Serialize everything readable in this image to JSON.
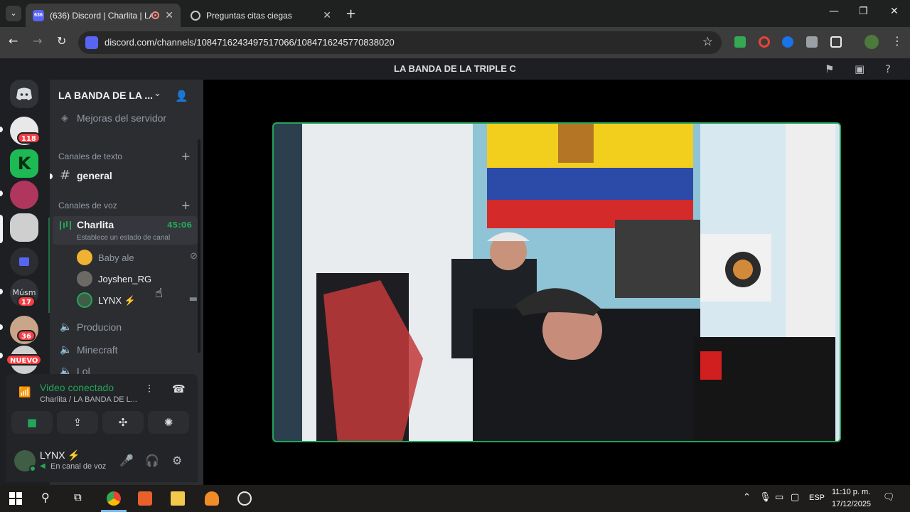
{
  "browser": {
    "tabs": [
      {
        "title": "(636) Discord | Charlita | LA",
        "favicon_badge": "636",
        "active": true,
        "recording": true
      },
      {
        "title": "Preguntas citas ciegas",
        "active": false
      }
    ],
    "url": "discord.com/channels/1084716243497517066/1084716245770838020",
    "icons": [
      "tab-search-icon",
      "close-icon",
      "new-tab-icon",
      "minimize-icon",
      "restore-icon",
      "back-icon",
      "forward-icon",
      "reload-icon",
      "star-icon",
      "extensions-icon",
      "more-icon"
    ]
  },
  "discord": {
    "title": "LA BANDA DE LA TRIPLE C",
    "guild_name": "LA BANDA DE LA ...",
    "boosts": "Mejoras del servidor",
    "text_category": "Canales de texto",
    "text_channels": [
      "general"
    ],
    "voice_category": "Canales de voz",
    "active_voice": {
      "name": "Charlita",
      "time": "45:06",
      "status_hint": "Establece un estado de canal",
      "members": [
        {
          "name": "Baby ale",
          "color": "#949ba4",
          "avatar_color": "#f0b232"
        },
        {
          "name": "Joyshen_RG",
          "color": "#f2f3f5",
          "avatar_color": "#6d6a66"
        },
        {
          "name": "LYNX ⚡",
          "color": "#f2f3f5",
          "avatar_color": "#3f5e45"
        }
      ]
    },
    "other_voice": [
      "Producion",
      "Minecraft",
      "Lol"
    ],
    "servers": [
      {
        "badge": "118",
        "color": "#e8e8e8"
      },
      {
        "badge": "",
        "color": "#1db954"
      },
      {
        "badge": "",
        "color": "#b0365e"
      },
      {
        "badge": "",
        "color": "#cfcfcf"
      },
      {
        "badge": "",
        "color": "#5865f2"
      },
      {
        "label": "Músm",
        "badge": "17",
        "color": "#2b2d31"
      },
      {
        "badge": "36",
        "color": "#c9a58a"
      },
      {
        "label": "NUEVO",
        "badge": "",
        "color": "#f23f43"
      }
    ],
    "voice_panel": {
      "title": "Video conectado",
      "sub": "Charlita / LA BANDA DE L..."
    },
    "user": {
      "name": "LYNX ⚡",
      "status": "En canal de voz"
    }
  },
  "taskbar": {
    "lang": "ESP",
    "time": "11:10 p. m.",
    "date": "17/12/2025"
  }
}
